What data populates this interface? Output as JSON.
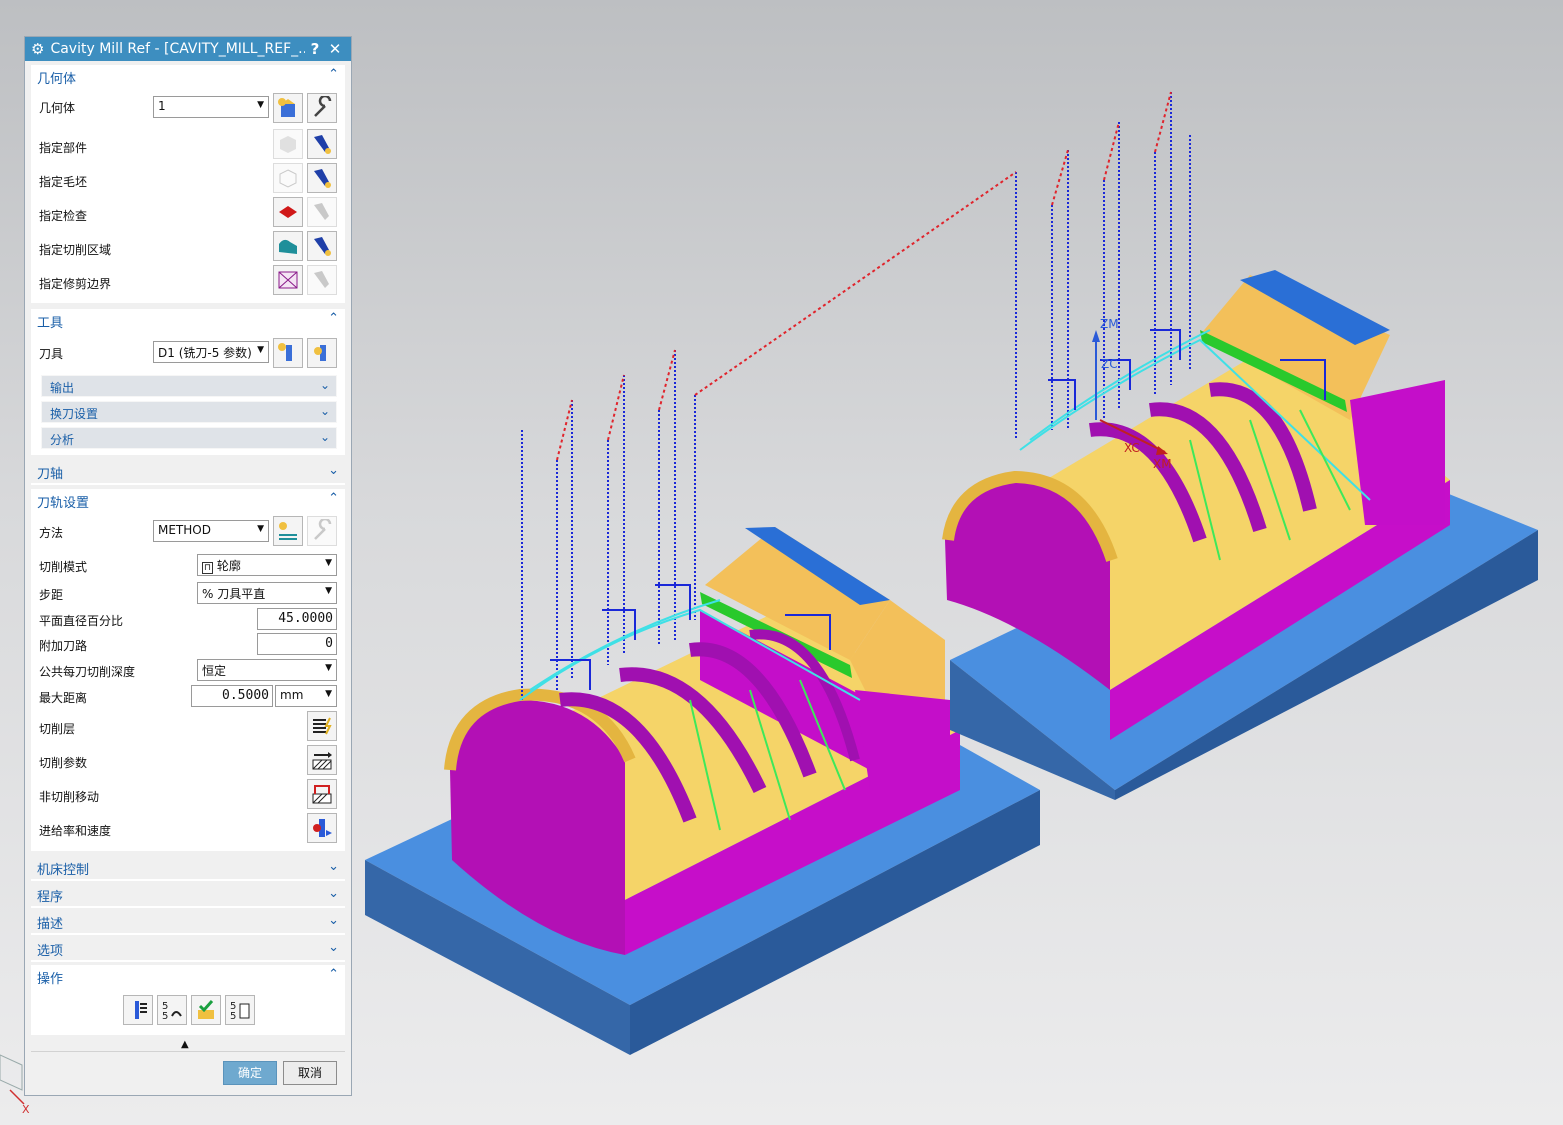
{
  "dialog": {
    "title": "Cavity Mill Ref - [CAVITY_MILL_REF_...",
    "help_label": "?",
    "close_label": "✕",
    "geometry": {
      "header": "几何体",
      "geometry_label": "几何体",
      "geometry_value": "1",
      "specify_part": "指定部件",
      "specify_blank": "指定毛坯",
      "specify_check": "指定检查",
      "specify_cut_area": "指定切削区域",
      "specify_trim_boundary": "指定修剪边界"
    },
    "tool": {
      "header": "工具",
      "tool_label": "刀具",
      "tool_value": "D1 (铣刀-5 参数)",
      "output": "输出",
      "tool_change": "换刀设置",
      "analysis": "分析"
    },
    "tool_axis": {
      "header": "刀轴"
    },
    "path_settings": {
      "header": "刀轨设置",
      "method_label": "方法",
      "method_value": "METHOD",
      "cut_pattern_label": "切削模式",
      "cut_pattern_value": "轮廓",
      "stepover_label": "步距",
      "stepover_value": "% 刀具平直",
      "flat_diameter_label": "平面直径百分比",
      "flat_diameter_value": "45.0000",
      "additional_passes_label": "附加刀路",
      "additional_passes_value": "0",
      "depth_per_cut_label": "公共每刀切削深度",
      "depth_per_cut_value": "恒定",
      "max_distance_label": "最大距离",
      "max_distance_value": "0.5000",
      "max_distance_unit": "mm",
      "cut_levels_label": "切削层",
      "cutting_params_label": "切削参数",
      "non_cutting_moves_label": "非切削移动",
      "feeds_speeds_label": "进给率和速度"
    },
    "machine_control": "机床控制",
    "program": "程序",
    "description": "描述",
    "options": "选项",
    "actions": {
      "header": "操作"
    },
    "ok_label": "确定",
    "cancel_label": "取消"
  },
  "viewport": {
    "axis_labels": {
      "zm": "ZM",
      "zc": "ZC",
      "xc": "XC",
      "xm": "XM"
    },
    "triad_x": "X"
  },
  "colors": {
    "title_bar": "#3d8ec0",
    "section_text": "#1a5fa8",
    "base_plate": "#3d7fd0",
    "part_yellow": "#f3d160",
    "part_magenta": "#c40ec9",
    "part_blue": "#2a6fd6",
    "toolpath_blue": "#1a28d8",
    "toolpath_red": "#e0242c",
    "toolpath_cyan": "#3fe0e6",
    "toolpath_green": "#3ee85a"
  }
}
